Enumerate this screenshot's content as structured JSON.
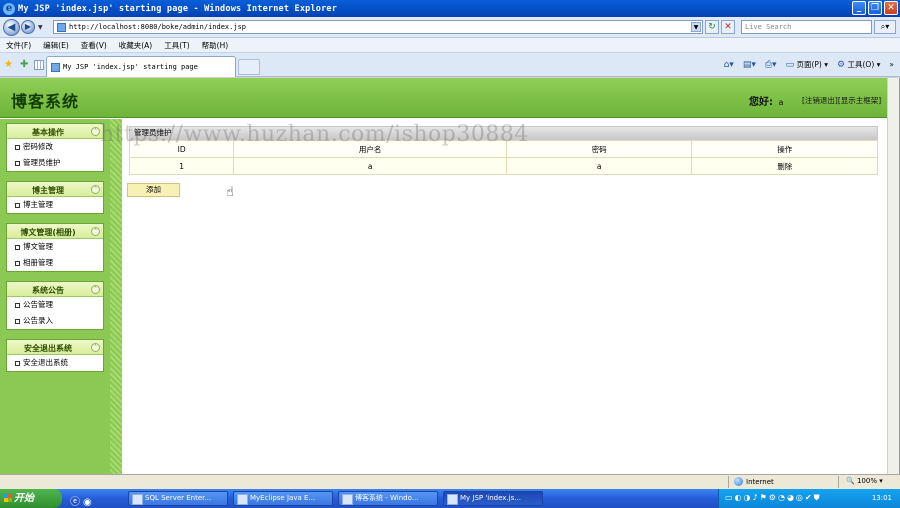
{
  "window": {
    "title": "My JSP 'index.jsp' starting page - Windows Internet Explorer"
  },
  "address": {
    "url": "http://localhost:8080/boke/admin/index.jsp",
    "search_placeholder": "Live Search"
  },
  "menu": [
    "文件(F)",
    "编辑(E)",
    "查看(V)",
    "收藏夹(A)",
    "工具(T)",
    "帮助(H)"
  ],
  "tab": {
    "label": "My JSP 'index.jsp' starting page"
  },
  "toolbar": {
    "page_label": "页面(P)",
    "tools_label": "工具(O)"
  },
  "header": {
    "title": "博客系统",
    "hello": "您好:",
    "user": "a",
    "logout": "[注销退出]",
    "show_main": "[显示主框架]"
  },
  "sidebar": {
    "groups": [
      {
        "title": "基本操作",
        "items": [
          "密码修改",
          "管理员维护"
        ]
      },
      {
        "title": "博主管理",
        "items": [
          "博主管理"
        ]
      },
      {
        "title": "博文管理(相册)",
        "items": [
          "博文管理",
          "相册管理"
        ]
      },
      {
        "title": "系统公告",
        "items": [
          "公告管理",
          "公告录入"
        ]
      },
      {
        "title": "安全退出系统",
        "items": [
          "安全退出系统"
        ]
      }
    ]
  },
  "panel": {
    "title": "管理员维护",
    "columns": [
      "ID",
      "用户名",
      "密码",
      "操作"
    ],
    "rows": [
      [
        "1",
        "a",
        "a",
        "删除"
      ]
    ],
    "add_label": "添加"
  },
  "watermark": "https://www.huzhan.com/ishop30884",
  "status": {
    "zone": "Internet",
    "zoom": "100%"
  },
  "taskbar": {
    "start": "开始",
    "tasks": [
      "SQL Server Enter...",
      "MyEclipse Java E...",
      "博客系统 - Windo...",
      "My JSP 'index.js..."
    ],
    "clock": "13:01"
  }
}
